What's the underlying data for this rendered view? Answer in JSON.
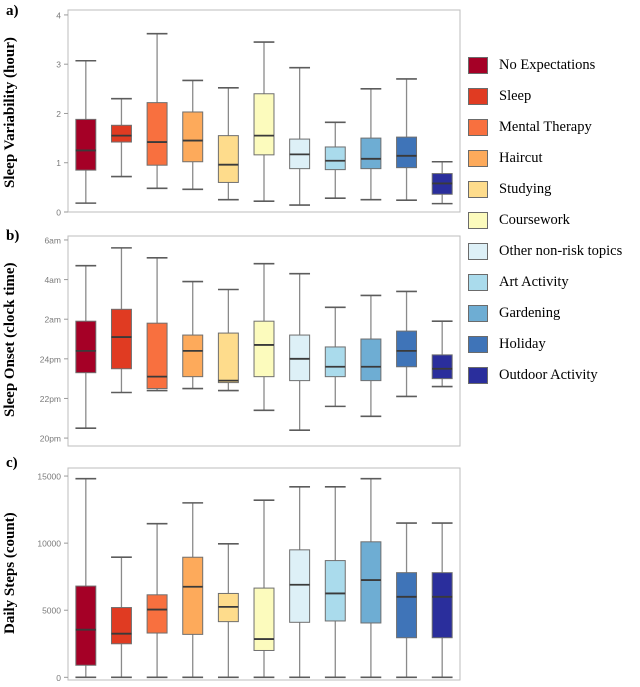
{
  "figure": {
    "panels": [
      {
        "tag": "a)",
        "axis_title_line1": "Sleep Variability",
        "axis_title_line2": "(hour)",
        "ylabel": "Sleep Variability (hour)",
        "yticks": [
          "0",
          "1",
          "2",
          "3",
          "4"
        ],
        "ytick_values": [
          0,
          1,
          2,
          3,
          4
        ],
        "ylim": [
          0,
          4.1
        ]
      },
      {
        "tag": "b)",
        "axis_title_line1": "Sleep Onset",
        "axis_title_line2": "(clock time)",
        "ylabel": "Sleep Onset (clock time)",
        "yticks": [
          "20pm",
          "22pm",
          "24pm",
          "2am",
          "4am",
          "6am"
        ],
        "ytick_values": [
          20,
          22,
          24,
          26,
          28,
          30
        ],
        "ylim": [
          19.6,
          30.2
        ]
      },
      {
        "tag": "c)",
        "axis_title_line1": "Daily Steps",
        "axis_title_line2": "(count)",
        "ylabel": "Daily Steps (count)",
        "yticks": [
          "0",
          "5000",
          "10000",
          "15000"
        ],
        "ytick_values": [
          0,
          5000,
          10000,
          15000
        ],
        "ylim": [
          -200,
          15600
        ]
      }
    ]
  },
  "legend": {
    "position": "right",
    "items": [
      {
        "label": "No Expectations",
        "color": "#a50026"
      },
      {
        "label": "Sleep",
        "color": "#e03b22"
      },
      {
        "label": "Mental Therapy",
        "color": "#f8703f"
      },
      {
        "label": "Haircut",
        "color": "#fdaa5b"
      },
      {
        "label": "Studying",
        "color": "#fedc8c"
      },
      {
        "label": "Coursework",
        "color": "#fcfbbd"
      },
      {
        "label": "Other non-risk topics",
        "color": "#ddf0f7"
      },
      {
        "label": "Art Activity",
        "color": "#aadbec"
      },
      {
        "label": "Gardening",
        "color": "#6eadd3"
      },
      {
        "label": "Holiday",
        "color": "#3f74b8"
      },
      {
        "label": "Outdoor Activity",
        "color": "#2a2e9c"
      }
    ]
  },
  "chart_data": [
    {
      "type": "box",
      "panel": "a",
      "title": "",
      "xlabel": "",
      "ylabel": "Sleep Variability (hour)",
      "ylim": [
        0,
        4.1
      ],
      "yticks": [
        0,
        1,
        2,
        3,
        4
      ],
      "grid": false,
      "legend_position": "right",
      "categories": [
        "No Expectations",
        "Sleep",
        "Mental Therapy",
        "Haircut",
        "Studying",
        "Coursework",
        "Other non-risk topics",
        "Art Activity",
        "Gardening",
        "Holiday",
        "Outdoor Activity"
      ],
      "boxes": [
        {
          "name": "No Expectations",
          "whisker_low": 0.18,
          "q1": 0.85,
          "median": 1.25,
          "q3": 1.88,
          "whisker_high": 3.07
        },
        {
          "name": "Sleep",
          "whisker_low": 0.72,
          "q1": 1.42,
          "median": 1.55,
          "q3": 1.76,
          "whisker_high": 2.3
        },
        {
          "name": "Mental Therapy",
          "whisker_low": 0.48,
          "q1": 0.95,
          "median": 1.42,
          "q3": 2.22,
          "whisker_high": 3.62
        },
        {
          "name": "Haircut",
          "whisker_low": 0.46,
          "q1": 1.02,
          "median": 1.45,
          "q3": 2.03,
          "whisker_high": 2.67
        },
        {
          "name": "Studying",
          "whisker_low": 0.25,
          "q1": 0.6,
          "median": 0.96,
          "q3": 1.55,
          "whisker_high": 2.52
        },
        {
          "name": "Coursework",
          "whisker_low": 0.22,
          "q1": 1.16,
          "median": 1.55,
          "q3": 2.4,
          "whisker_high": 3.45
        },
        {
          "name": "Other non-risk topics",
          "whisker_low": 0.14,
          "q1": 0.88,
          "median": 1.17,
          "q3": 1.48,
          "whisker_high": 2.93
        },
        {
          "name": "Art Activity",
          "whisker_low": 0.28,
          "q1": 0.86,
          "median": 1.04,
          "q3": 1.32,
          "whisker_high": 1.82
        },
        {
          "name": "Gardening",
          "whisker_low": 0.25,
          "q1": 0.88,
          "median": 1.08,
          "q3": 1.5,
          "whisker_high": 2.5
        },
        {
          "name": "Holiday",
          "whisker_low": 0.24,
          "q1": 0.9,
          "median": 1.14,
          "q3": 1.52,
          "whisker_high": 2.7
        },
        {
          "name": "Outdoor Activity",
          "whisker_low": 0.17,
          "q1": 0.36,
          "median": 0.58,
          "q3": 0.78,
          "whisker_high": 1.02
        }
      ]
    },
    {
      "type": "box",
      "panel": "b",
      "title": "",
      "xlabel": "",
      "ylabel": "Sleep Onset (clock time)",
      "ylim": [
        19.6,
        30.2
      ],
      "yticks": [
        20,
        22,
        24,
        26,
        28,
        30
      ],
      "ytick_labels": [
        "20pm",
        "22pm",
        "24pm",
        "2am",
        "4am",
        "6am"
      ],
      "grid": false,
      "legend_position": "right",
      "categories": [
        "No Expectations",
        "Sleep",
        "Mental Therapy",
        "Haircut",
        "Studying",
        "Coursework",
        "Other non-risk topics",
        "Art Activity",
        "Gardening",
        "Holiday",
        "Outdoor Activity"
      ],
      "boxes": [
        {
          "name": "No Expectations",
          "whisker_low": 20.5,
          "q1": 23.3,
          "median": 24.4,
          "q3": 25.9,
          "whisker_high": 28.7
        },
        {
          "name": "Sleep",
          "whisker_low": 22.3,
          "q1": 23.5,
          "median": 25.1,
          "q3": 26.5,
          "whisker_high": 29.6
        },
        {
          "name": "Mental Therapy",
          "whisker_low": 22.4,
          "q1": 22.5,
          "median": 23.1,
          "q3": 25.8,
          "whisker_high": 29.1
        },
        {
          "name": "Haircut",
          "whisker_low": 22.5,
          "q1": 23.1,
          "median": 24.4,
          "q3": 25.2,
          "whisker_high": 27.9
        },
        {
          "name": "Studying",
          "whisker_low": 22.4,
          "q1": 22.8,
          "median": 22.9,
          "q3": 25.3,
          "whisker_high": 27.5
        },
        {
          "name": "Coursework",
          "whisker_low": 21.4,
          "q1": 23.1,
          "median": 24.7,
          "q3": 25.9,
          "whisker_high": 28.8
        },
        {
          "name": "Other non-risk topics",
          "whisker_low": 20.4,
          "q1": 22.9,
          "median": 24.0,
          "q3": 25.2,
          "whisker_high": 28.3
        },
        {
          "name": "Art Activity",
          "whisker_low": 21.6,
          "q1": 23.1,
          "median": 23.6,
          "q3": 24.6,
          "whisker_high": 26.6
        },
        {
          "name": "Gardening",
          "whisker_low": 21.1,
          "q1": 22.9,
          "median": 23.6,
          "q3": 25.0,
          "whisker_high": 27.2
        },
        {
          "name": "Holiday",
          "whisker_low": 22.1,
          "q1": 23.6,
          "median": 24.4,
          "q3": 25.4,
          "whisker_high": 27.4
        },
        {
          "name": "Outdoor Activity",
          "whisker_low": 22.6,
          "q1": 23.0,
          "median": 23.5,
          "q3": 24.2,
          "whisker_high": 25.9
        }
      ]
    },
    {
      "type": "box",
      "panel": "c",
      "title": "",
      "xlabel": "",
      "ylabel": "Daily Steps (count)",
      "ylim": [
        -200,
        15600
      ],
      "yticks": [
        0,
        5000,
        10000,
        15000
      ],
      "grid": false,
      "legend_position": "right",
      "categories": [
        "No Expectations",
        "Sleep",
        "Mental Therapy",
        "Haircut",
        "Studying",
        "Coursework",
        "Other non-risk topics",
        "Art Activity",
        "Gardening",
        "Holiday",
        "Outdoor Activity"
      ],
      "boxes": [
        {
          "name": "No Expectations",
          "whisker_low": 0,
          "q1": 900,
          "median": 3550,
          "q3": 6800,
          "whisker_high": 14800
        },
        {
          "name": "Sleep",
          "whisker_low": 0,
          "q1": 2500,
          "median": 3250,
          "q3": 5200,
          "whisker_high": 8950
        },
        {
          "name": "Mental Therapy",
          "whisker_low": 0,
          "q1": 3300,
          "median": 5050,
          "q3": 6150,
          "whisker_high": 11450
        },
        {
          "name": "Haircut",
          "whisker_low": 0,
          "q1": 3200,
          "median": 6750,
          "q3": 8950,
          "whisker_high": 13000
        },
        {
          "name": "Studying",
          "whisker_low": 0,
          "q1": 4150,
          "median": 5250,
          "q3": 6250,
          "whisker_high": 9950
        },
        {
          "name": "Coursework",
          "whisker_low": 0,
          "q1": 2000,
          "median": 2850,
          "q3": 6650,
          "whisker_high": 13200
        },
        {
          "name": "Other non-risk topics",
          "whisker_low": 0,
          "q1": 4100,
          "median": 6900,
          "q3": 9500,
          "whisker_high": 14200
        },
        {
          "name": "Art Activity",
          "whisker_low": 0,
          "q1": 4200,
          "median": 6250,
          "q3": 8700,
          "whisker_high": 14200
        },
        {
          "name": "Gardening",
          "whisker_low": 0,
          "q1": 4050,
          "median": 7250,
          "q3": 10100,
          "whisker_high": 14800
        },
        {
          "name": "Holiday",
          "whisker_low": 0,
          "q1": 2950,
          "median": 6000,
          "q3": 7800,
          "whisker_high": 11500
        },
        {
          "name": "Outdoor Activity",
          "whisker_low": 0,
          "q1": 2950,
          "median": 6000,
          "q3": 7800,
          "whisker_high": 11500
        }
      ]
    }
  ]
}
